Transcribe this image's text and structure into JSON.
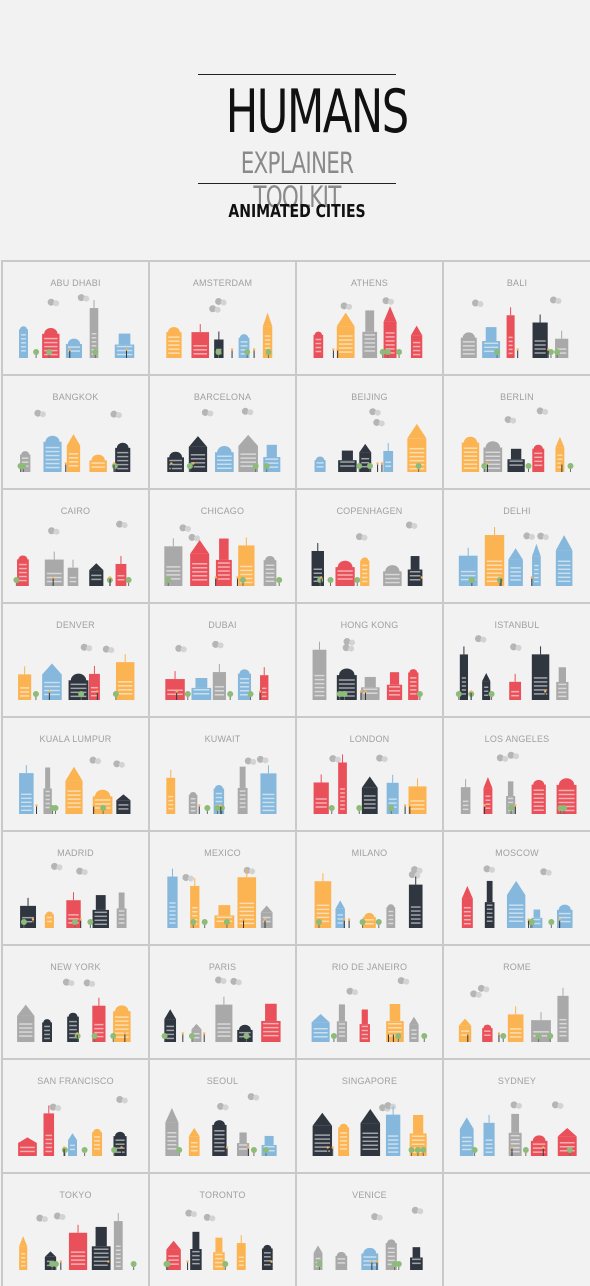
{
  "header": {
    "title": "HUMANS",
    "subtitle": "EXPLAINER TOOLKIT",
    "section": "ANIMATED CITIES"
  },
  "palette": {
    "background": "#f2f2f2",
    "grid_line": "#c9c9c9",
    "label": "#a0a0a0",
    "red": "#e9505a",
    "orange": "#fbb451",
    "blue": "#85b8dc",
    "dark": "#2f3640",
    "gray": "#a9a9a9",
    "light_gray": "#cfcfcf",
    "green": "#8dbb78"
  },
  "cities": [
    {
      "name": "ABU DHABI"
    },
    {
      "name": "AMSTERDAM"
    },
    {
      "name": "ATHENS"
    },
    {
      "name": "BALI"
    },
    {
      "name": "BANGKOK"
    },
    {
      "name": "BARCELONA"
    },
    {
      "name": "BEIJING"
    },
    {
      "name": "BERLIN"
    },
    {
      "name": "CAIRO"
    },
    {
      "name": "CHICAGO"
    },
    {
      "name": "COPENHAGEN"
    },
    {
      "name": "DELHI"
    },
    {
      "name": "DENVER"
    },
    {
      "name": "DUBAI"
    },
    {
      "name": "HONG KONG"
    },
    {
      "name": "ISTANBUL"
    },
    {
      "name": "KUALA LUMPUR"
    },
    {
      "name": "KUWAIT"
    },
    {
      "name": "LONDON"
    },
    {
      "name": "LOS ANGELES"
    },
    {
      "name": "MADRID"
    },
    {
      "name": "MEXICO"
    },
    {
      "name": "MILANO"
    },
    {
      "name": "MOSCOW"
    },
    {
      "name": "NEW YORK"
    },
    {
      "name": "PARIS"
    },
    {
      "name": "RIO DE JANEIRO"
    },
    {
      "name": "ROME"
    },
    {
      "name": "SAN FRANCISCO"
    },
    {
      "name": "SEOUL"
    },
    {
      "name": "SINGAPORE"
    },
    {
      "name": "SYDNEY"
    },
    {
      "name": "TOKYO"
    },
    {
      "name": "TORONTO"
    },
    {
      "name": "VENICE"
    }
  ]
}
